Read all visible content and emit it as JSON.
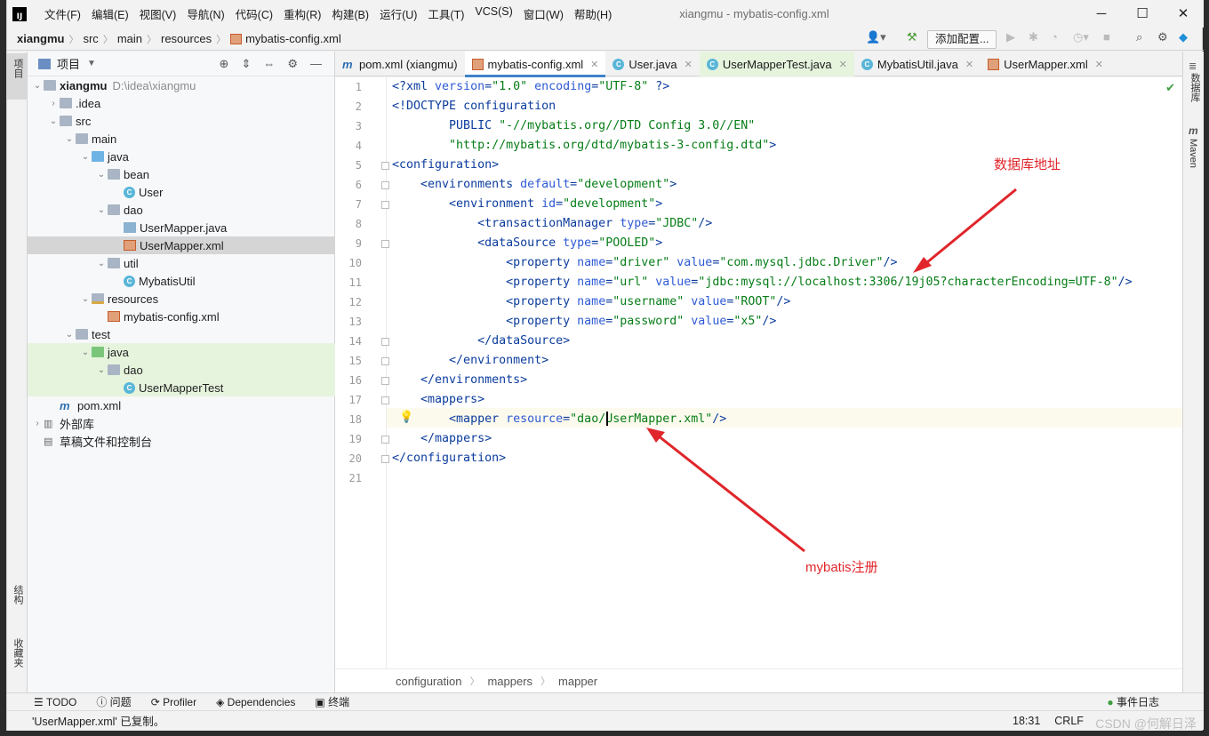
{
  "window": {
    "title": "xiangmu - mybatis-config.xml",
    "app_logo": "IJ"
  },
  "menu": [
    "文件(F)",
    "编辑(E)",
    "视图(V)",
    "导航(N)",
    "代码(C)",
    "重构(R)",
    "构建(B)",
    "运行(U)",
    "工具(T)",
    "VCS(S)",
    "窗口(W)",
    "帮助(H)"
  ],
  "breadcrumb": [
    "xiangmu",
    "src",
    "main",
    "resources",
    "mybatis-config.xml"
  ],
  "toolbar": {
    "add_config": "添加配置..."
  },
  "left_strip": {
    "project": "项目",
    "structure": "结构",
    "favorites": "收藏夹"
  },
  "right_strip": {
    "database": "数据库",
    "maven": "Maven"
  },
  "project_panel": {
    "title": "项目",
    "tree": [
      {
        "label": "xiangmu",
        "extra": "D:\\idea\\xiangmu",
        "icon": "folder",
        "arrow": "down",
        "level": 0,
        "bold": true
      },
      {
        "label": ".idea",
        "icon": "folder",
        "arrow": "right",
        "level": 1
      },
      {
        "label": "src",
        "icon": "folder",
        "arrow": "down",
        "level": 1
      },
      {
        "label": "main",
        "icon": "folder",
        "arrow": "down",
        "level": 2
      },
      {
        "label": "java",
        "icon": "folder-blue",
        "arrow": "down",
        "level": 3
      },
      {
        "label": "bean",
        "icon": "folder",
        "arrow": "down",
        "level": 4
      },
      {
        "label": "User",
        "icon": "class",
        "arrow": "",
        "level": 5
      },
      {
        "label": "dao",
        "icon": "folder",
        "arrow": "down",
        "level": 4
      },
      {
        "label": "UserMapper.java",
        "icon": "java",
        "arrow": "",
        "level": 5
      },
      {
        "label": "UserMapper.xml",
        "icon": "xml",
        "arrow": "",
        "level": 5,
        "selected": true
      },
      {
        "label": "util",
        "icon": "folder",
        "arrow": "down",
        "level": 4
      },
      {
        "label": "MybatisUtil",
        "icon": "class",
        "arrow": "",
        "level": 5
      },
      {
        "label": "resources",
        "icon": "folder-res",
        "arrow": "down",
        "level": 3
      },
      {
        "label": "mybatis-config.xml",
        "icon": "xml",
        "arrow": "",
        "level": 4
      },
      {
        "label": "test",
        "icon": "folder",
        "arrow": "down",
        "level": 2
      },
      {
        "label": "java",
        "icon": "folder-green",
        "arrow": "down",
        "level": 3,
        "test": true
      },
      {
        "label": "dao",
        "icon": "folder",
        "arrow": "down",
        "level": 4,
        "test": true
      },
      {
        "label": "UserMapperTest",
        "icon": "class",
        "arrow": "",
        "level": 5,
        "test": true
      },
      {
        "label": "pom.xml",
        "icon": "maven",
        "arrow": "",
        "level": 1
      },
      {
        "label": "外部库",
        "icon": "library",
        "arrow": "right",
        "level": 0
      },
      {
        "label": "草稿文件和控制台",
        "icon": "scratch",
        "arrow": "",
        "level": 0
      }
    ]
  },
  "tabs": [
    {
      "label": "pom.xml (xiangmu)",
      "icon": "maven",
      "closable": false
    },
    {
      "label": "mybatis-config.xml",
      "icon": "xml",
      "active": true,
      "closable": true
    },
    {
      "label": "User.java",
      "icon": "class",
      "closable": true
    },
    {
      "label": "UserMapperTest.java",
      "icon": "class",
      "test": true,
      "closable": true
    },
    {
      "label": "MybatisUtil.java",
      "icon": "class",
      "closable": true
    },
    {
      "label": "UserMapper.xml",
      "icon": "xml",
      "closable": true
    }
  ],
  "code_lines": [
    "<?xml version=\"1.0\" encoding=\"UTF-8\" ?>",
    "<!DOCTYPE configuration",
    "        PUBLIC \"-//mybatis.org//DTD Config 3.0//EN\"",
    "        \"http://mybatis.org/dtd/mybatis-3-config.dtd\">",
    "<configuration>",
    "    <environments default=\"development\">",
    "        <environment id=\"development\">",
    "            <transactionManager type=\"JDBC\"/>",
    "            <dataSource type=\"POOLED\">",
    "                <property name=\"driver\" value=\"com.mysql.jdbc.Driver\"/>",
    "                <property name=\"url\" value=\"jdbc:mysql://localhost:3306/19j05?characterEncoding=UTF-8\"/>",
    "                <property name=\"username\" value=\"ROOT\"/>",
    "                <property name=\"password\" value=\"x5\"/>",
    "            </dataSource>",
    "        </environment>",
    "    </environments>",
    "    <mappers>",
    "        <mapper resource=\"dao/UserMapper.xml\"/>",
    "    </mappers>",
    "</configuration>",
    ""
  ],
  "editor_breadcrumb": [
    "configuration",
    "mappers",
    "mapper"
  ],
  "annotations": {
    "db_address": "数据库地址",
    "mybatis_register": "mybatis注册"
  },
  "tool_windows": [
    "TODO",
    "问题",
    "Profiler",
    "Dependencies",
    "终端"
  ],
  "event_log": "事件日志",
  "status": {
    "message": "'UserMapper.xml' 已复制。",
    "position": "18:31",
    "line_sep": "CRLF",
    "watermark": "CSDN @何解日泽"
  },
  "colors": {
    "tag": "#0b3c9d",
    "attr": "#2e5ad4",
    "value": "#067d17",
    "annotation": "#e0262b",
    "tab_active": "#4083c9"
  }
}
